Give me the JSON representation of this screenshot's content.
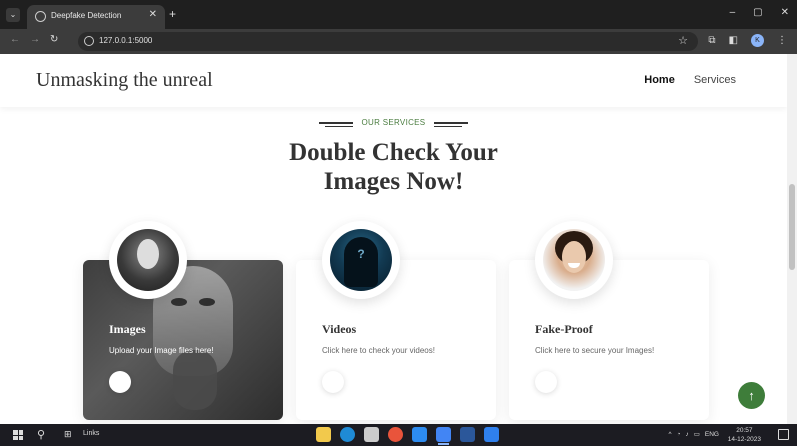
{
  "browser": {
    "tab_title": "Deepfake Detection",
    "url": "127.0.0.1:5000",
    "profile_initial": "K"
  },
  "site": {
    "logo": "Unmasking the unreal",
    "nav": [
      {
        "label": "Home",
        "active": true
      },
      {
        "label": "Services",
        "active": false
      }
    ]
  },
  "section": {
    "eyebrow": "OUR SERVICES",
    "heading_line1": "Double Check Your",
    "heading_line2": "Images Now!"
  },
  "cards": [
    {
      "title": "Images",
      "text": "Upload your Image files here!",
      "avatar": "masked-person-image"
    },
    {
      "title": "Videos",
      "text": "Click here to check your videos!",
      "avatar": "hooded-hacker-image"
    },
    {
      "title": "Fake-Proof",
      "text": "Click here to secure your Images!",
      "avatar": "smiling-woman-image"
    }
  ],
  "taskbar": {
    "links_label": "Links",
    "lang": "ENG",
    "time": "20:57",
    "date": "14-12-2023"
  },
  "colors": {
    "accent_green": "#3e7d3a",
    "eyebrow_green": "#4a7c3f"
  }
}
